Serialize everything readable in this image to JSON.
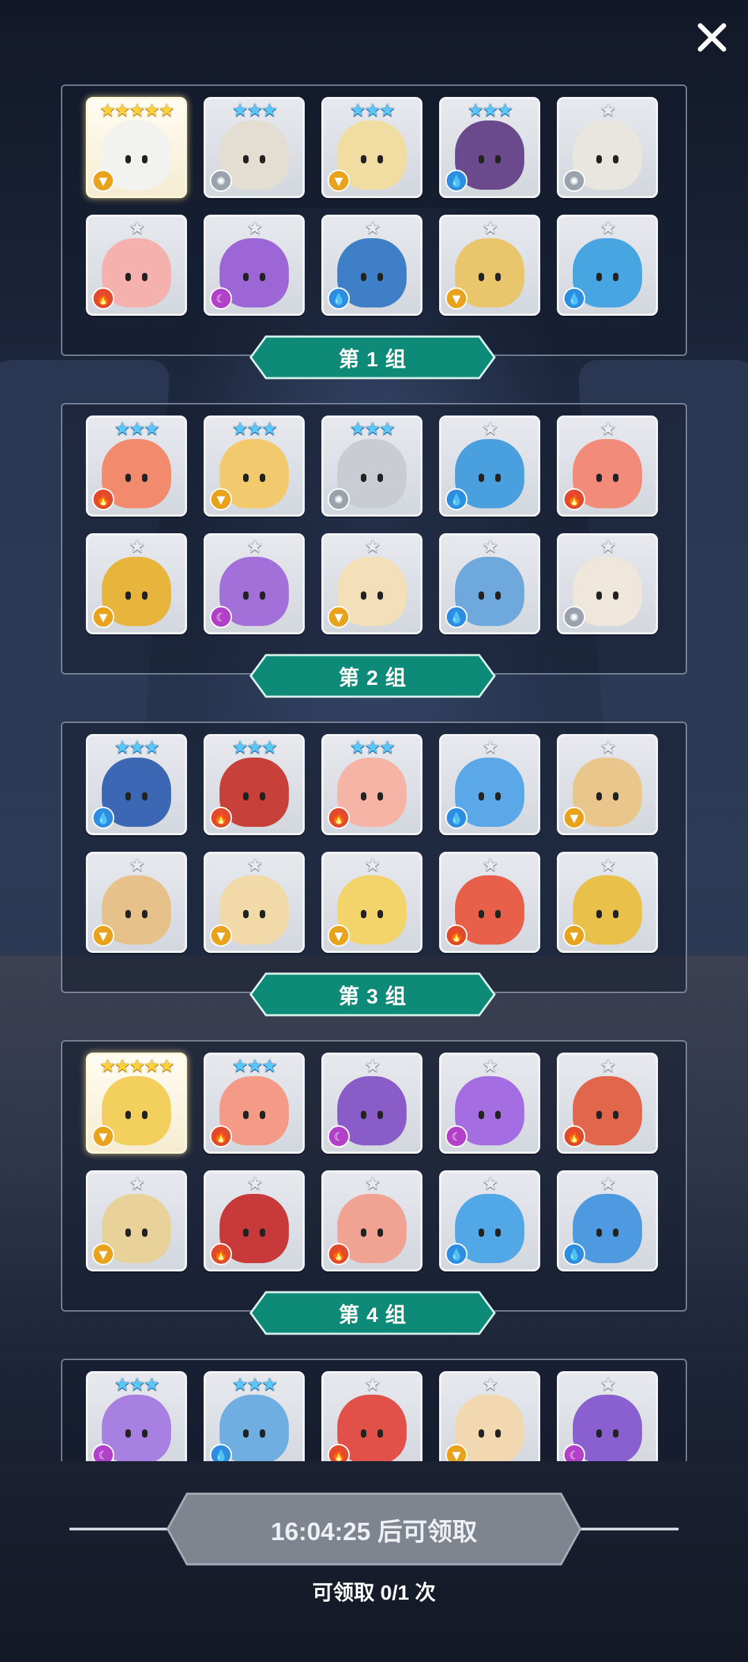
{
  "colors": {
    "panel_border": "#c8d2e6",
    "label_teal": "#0e8a78",
    "button_gray": "#7e858f",
    "star_gold": "#ffd23a",
    "star_blue": "#58c8ff",
    "star_silver": "#e8ebf0"
  },
  "close_icon": "close-icon",
  "groups": [
    {
      "label": "第 1 组",
      "cards": [
        {
          "stars": "★★★★★",
          "tier": "gold",
          "element": "wind",
          "color": "#f2f2f0",
          "legend": true
        },
        {
          "stars": "★★★",
          "tier": "blue",
          "element": "light",
          "color": "#e4ddd2"
        },
        {
          "stars": "★★★",
          "tier": "blue",
          "element": "wind",
          "color": "#f1dca2"
        },
        {
          "stars": "★★★",
          "tier": "blue",
          "element": "water",
          "color": "#6a4a8c"
        },
        {
          "stars": "★",
          "tier": "silver",
          "element": "light",
          "color": "#e9e6df"
        },
        {
          "stars": "★",
          "tier": "silver",
          "element": "fire",
          "color": "#f4b1ae"
        },
        {
          "stars": "★",
          "tier": "silver",
          "element": "dark",
          "color": "#9d66d6"
        },
        {
          "stars": "★",
          "tier": "silver",
          "element": "water",
          "color": "#3f7fc8"
        },
        {
          "stars": "★",
          "tier": "silver",
          "element": "wind",
          "color": "#e9c66b"
        },
        {
          "stars": "★",
          "tier": "silver",
          "element": "water",
          "color": "#47a6e2"
        }
      ]
    },
    {
      "label": "第 2 组",
      "cards": [
        {
          "stars": "★★★",
          "tier": "blue",
          "element": "fire",
          "color": "#f28a6d"
        },
        {
          "stars": "★★★",
          "tier": "blue",
          "element": "wind",
          "color": "#f2c96c"
        },
        {
          "stars": "★★★",
          "tier": "blue",
          "element": "light",
          "color": "#c9ccd2"
        },
        {
          "stars": "★",
          "tier": "silver",
          "element": "water",
          "color": "#4aa0de"
        },
        {
          "stars": "★",
          "tier": "silver",
          "element": "fire",
          "color": "#f28b7a"
        },
        {
          "stars": "★",
          "tier": "silver",
          "element": "wind",
          "color": "#e7b43c"
        },
        {
          "stars": "★",
          "tier": "silver",
          "element": "dark",
          "color": "#a36fd8"
        },
        {
          "stars": "★",
          "tier": "silver",
          "element": "wind",
          "color": "#f3e0b8"
        },
        {
          "stars": "★",
          "tier": "silver",
          "element": "water",
          "color": "#6fa8dc"
        },
        {
          "stars": "★",
          "tier": "silver",
          "element": "light",
          "color": "#efe6dc"
        }
      ]
    },
    {
      "label": "第 3 组",
      "cards": [
        {
          "stars": "★★★",
          "tier": "blue",
          "element": "water",
          "color": "#3b67b5"
        },
        {
          "stars": "★★★",
          "tier": "blue",
          "element": "fire",
          "color": "#c8403a"
        },
        {
          "stars": "★★★",
          "tier": "blue",
          "element": "fire",
          "color": "#f5b4a6"
        },
        {
          "stars": "★",
          "tier": "silver",
          "element": "water",
          "color": "#5aa8e8"
        },
        {
          "stars": "★",
          "tier": "silver",
          "element": "wind",
          "color": "#e9c68c"
        },
        {
          "stars": "★",
          "tier": "silver",
          "element": "wind",
          "color": "#e6c28a"
        },
        {
          "stars": "★",
          "tier": "silver",
          "element": "wind",
          "color": "#f2d9a8"
        },
        {
          "stars": "★",
          "tier": "silver",
          "element": "wind",
          "color": "#f2d46a"
        },
        {
          "stars": "★",
          "tier": "silver",
          "element": "fire",
          "color": "#e8604a"
        },
        {
          "stars": "★",
          "tier": "silver",
          "element": "wind",
          "color": "#e8c04a"
        }
      ]
    },
    {
      "label": "第 4 组",
      "cards": [
        {
          "stars": "★★★★★",
          "tier": "gold",
          "element": "wind",
          "color": "#f3cf5e",
          "legend": true
        },
        {
          "stars": "★★★",
          "tier": "blue",
          "element": "fire",
          "color": "#f49a86"
        },
        {
          "stars": "★",
          "tier": "silver",
          "element": "dark",
          "color": "#8a5cc8"
        },
        {
          "stars": "★",
          "tier": "silver",
          "element": "dark",
          "color": "#a46ee2"
        },
        {
          "stars": "★",
          "tier": "silver",
          "element": "fire",
          "color": "#e2664c"
        },
        {
          "stars": "★",
          "tier": "silver",
          "element": "wind",
          "color": "#e9d29a"
        },
        {
          "stars": "★",
          "tier": "silver",
          "element": "fire",
          "color": "#c83a3a"
        },
        {
          "stars": "★",
          "tier": "silver",
          "element": "fire",
          "color": "#f0a392"
        },
        {
          "stars": "★",
          "tier": "silver",
          "element": "water",
          "color": "#52a8e6"
        },
        {
          "stars": "★",
          "tier": "silver",
          "element": "water",
          "color": "#4d9ae0"
        }
      ]
    },
    {
      "label": "",
      "cards": [
        {
          "stars": "★★★",
          "tier": "blue",
          "element": "dark",
          "color": "#a780e2"
        },
        {
          "stars": "★★★",
          "tier": "blue",
          "element": "water",
          "color": "#6eaee0"
        },
        {
          "stars": "★",
          "tier": "silver",
          "element": "fire",
          "color": "#e2504a"
        },
        {
          "stars": "★",
          "tier": "silver",
          "element": "wind",
          "color": "#f2d8b0"
        },
        {
          "stars": "★",
          "tier": "silver",
          "element": "dark",
          "color": "#8a5fd0"
        }
      ]
    }
  ],
  "claim": {
    "button_label": "16:04:25 后可领取",
    "count_text": "可领取 0/1 次"
  }
}
